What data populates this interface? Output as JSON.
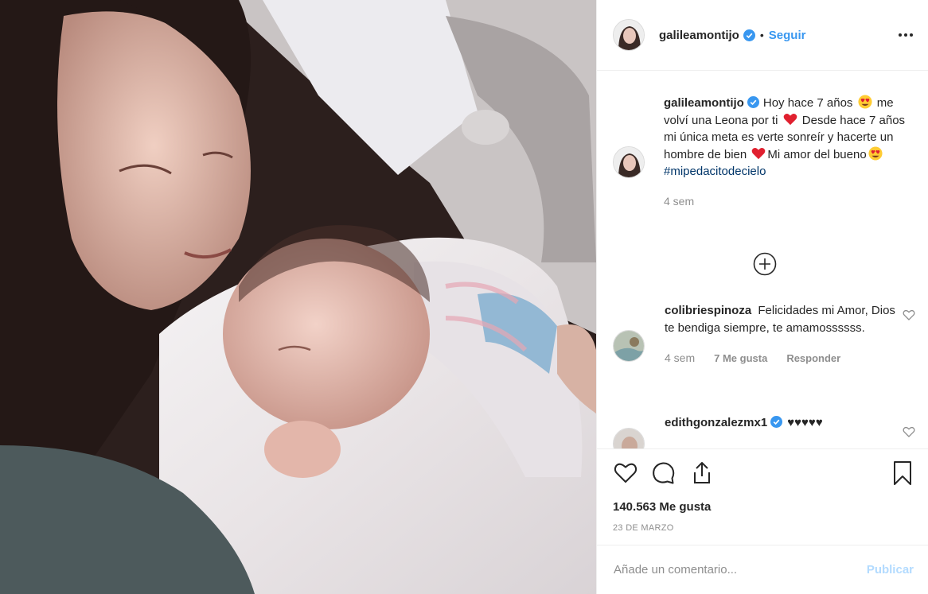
{
  "post": {
    "username": "galileamontijo",
    "dot": "•",
    "follow_label": "Seguir",
    "photo_icon": "photo-mother-newborn"
  },
  "caption": {
    "username": "galileamontijo",
    "text_1": "Hoy hace 7 años",
    "text_2": "me volví una Leona por ti",
    "text_3": "Desde hace 7 años mi única meta es verte sonreír y hacerte un hombre de bien",
    "text_4": "Mi amor del bueno",
    "hashtag": "#mipedacitodecielo",
    "time": "4 sem"
  },
  "comments": [
    {
      "username": "colibriespinoza",
      "text": "Felicidades mi Amor, Dios te bendiga siempre, te amamossssss.",
      "time": "4 sem",
      "likes": "7 Me gusta",
      "reply": "Responder"
    },
    {
      "username": "edithgonzalezmx1",
      "text": "♥♥♥♥♥"
    }
  ],
  "stats": {
    "likes": "140.563 Me gusta",
    "date": "23 DE MARZO"
  },
  "add_comment": {
    "placeholder": "Añade un comentario...",
    "publish_label": "Publicar"
  },
  "colors": {
    "link": "#3897f0",
    "hashtag": "#003569",
    "muted": "#8e8e8e",
    "publish_disabled": "#b3dbff",
    "verified": "#3897f0"
  }
}
